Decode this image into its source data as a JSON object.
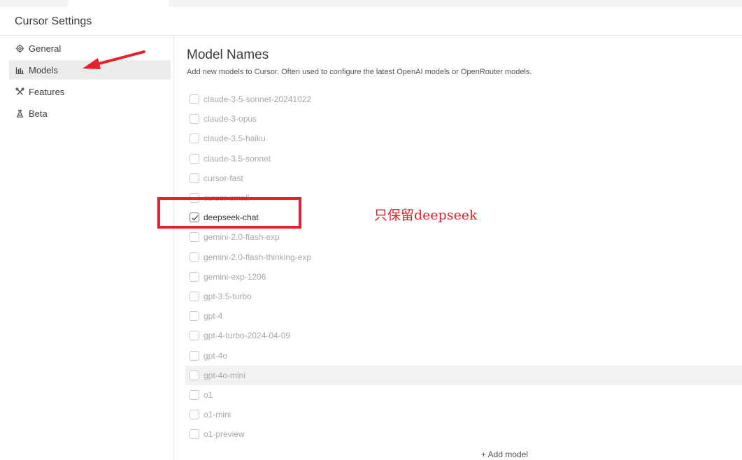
{
  "window": {
    "title": "Cursor Settings"
  },
  "sidebar": {
    "items": [
      {
        "label": "General",
        "icon": "gear-icon",
        "active": false
      },
      {
        "label": "Models",
        "icon": "bar-chart-icon",
        "active": true
      },
      {
        "label": "Features",
        "icon": "tools-icon",
        "active": false
      },
      {
        "label": "Beta",
        "icon": "flask-icon",
        "active": false
      }
    ]
  },
  "main": {
    "title": "Model Names",
    "description": "Add new models to Cursor. Often used to configure the latest OpenAI models or OpenRouter models.",
    "models": [
      {
        "name": "claude-3-5-sonnet-20241022",
        "checked": false
      },
      {
        "name": "claude-3-opus",
        "checked": false
      },
      {
        "name": "claude-3.5-haiku",
        "checked": false
      },
      {
        "name": "claude-3.5-sonnet",
        "checked": false
      },
      {
        "name": "cursor-fast",
        "checked": false
      },
      {
        "name": "cursor-small",
        "checked": false
      },
      {
        "name": "deepseek-chat",
        "checked": true
      },
      {
        "name": "gemini-2.0-flash-exp",
        "checked": false
      },
      {
        "name": "gemini-2.0-flash-thinking-exp",
        "checked": false
      },
      {
        "name": "gemini-exp-1206",
        "checked": false
      },
      {
        "name": "gpt-3.5-turbo",
        "checked": false
      },
      {
        "name": "gpt-4",
        "checked": false
      },
      {
        "name": "gpt-4-turbo-2024-04-09",
        "checked": false
      },
      {
        "name": "gpt-4o",
        "checked": false
      },
      {
        "name": "gpt-4o-mini",
        "checked": false,
        "hovered": true
      },
      {
        "name": "o1",
        "checked": false
      },
      {
        "name": "o1-mini",
        "checked": false
      },
      {
        "name": "o1-preview",
        "checked": false
      }
    ],
    "add_model_label": "+ Add model"
  },
  "annotation": {
    "text": "只保留deepseek",
    "color": "#e5222b"
  }
}
